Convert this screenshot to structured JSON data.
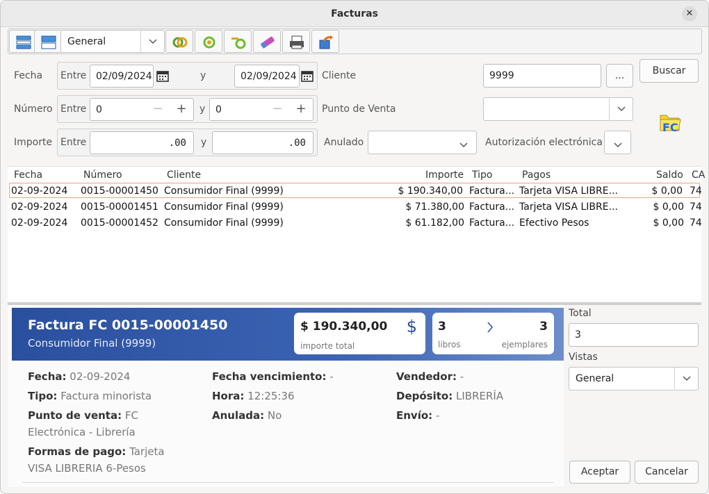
{
  "window": {
    "title": "Facturas"
  },
  "toolbar": {
    "view_selected": "General"
  },
  "filters": {
    "fecha_label": "Fecha",
    "entre_label": "Entre",
    "y_label": "y",
    "fecha_from": "02/09/2024",
    "fecha_to": "02/09/2024",
    "numero_label": "Número",
    "numero_from": "0",
    "numero_to": "0",
    "importe_label": "Importe",
    "importe_from": ".00",
    "importe_to": ".00",
    "cliente_label": "Cliente",
    "cliente_value": "9999",
    "ellipsis": "...",
    "buscar": "Buscar",
    "punto_venta_label": "Punto de Venta",
    "anulado_label": "Anulado",
    "autorizacion_label": "Autorización electrónica",
    "fc_logo": "FC"
  },
  "table": {
    "headers": [
      "Fecha",
      "Número",
      "Cliente",
      "Importe",
      "Tipo",
      "Pagos",
      "Saldo",
      "CA"
    ],
    "rows": [
      [
        "02-09-2024",
        "0015-00001450",
        "Consumidor Final (9999)",
        "$ 190.340,00",
        "Factura...",
        "Tarjeta VISA LIBRE...",
        "$ 0,00",
        "74"
      ],
      [
        "02-09-2024",
        "0015-00001451",
        "Consumidor Final (9999)",
        "$ 71.380,00",
        "Factura...",
        "Tarjeta VISA LIBRE...",
        "$ 0,00",
        "74"
      ],
      [
        "02-09-2024",
        "0015-00001452",
        "Consumidor Final (9999)",
        "$ 61.182,00",
        "Factura...",
        "Efectivo Pesos",
        "$ 0,00",
        "74"
      ]
    ]
  },
  "detail": {
    "title": "Factura FC 0015-00001450",
    "subtitle": "Consumidor Final (9999)",
    "importe_total": "$ 190.340,00",
    "importe_total_label": "importe total",
    "currency_symbol": "$",
    "libros": "3",
    "libros_label": "libros",
    "ejemplares": "3",
    "ejemplares_label": "ejemplares",
    "fecha_k": "Fecha:",
    "fecha_v": "02-09-2024",
    "tipo_k": "Tipo:",
    "tipo_v": "Factura minorista",
    "pv_k": "Punto de venta:",
    "pv_v1": "FC",
    "pv_v2": "Electrónica - Librería",
    "fp_k": "Formas de pago:",
    "fp_v1": "Tarjeta",
    "fp_v2": "VISA LIBRERIA 6-Pesos",
    "venc_k": "Fecha vencimiento:",
    "venc_v": "-",
    "hora_k": "Hora:",
    "hora_v": "12:25:36",
    "anul_k": "Anulada:",
    "anul_v": "No",
    "vend_k": "Vendedor:",
    "vend_v": "-",
    "dep_k": "Depósito:",
    "dep_v": "LIBRERÍA",
    "env_k": "Envío:",
    "env_v": "-"
  },
  "side": {
    "total_label": "Total",
    "total_value": "3",
    "vistas_label": "Vistas",
    "vistas_value": "General",
    "aceptar": "Aceptar",
    "cancelar": "Cancelar"
  }
}
